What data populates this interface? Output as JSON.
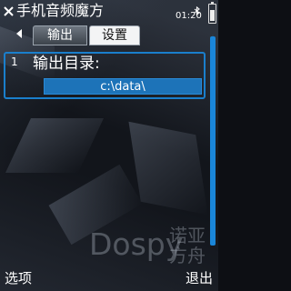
{
  "header": {
    "title": "手机音频魔方",
    "clock": "01:20",
    "close_icon": "close-icon",
    "bluetooth_icon": "bluetooth-icon",
    "battery_icon": "battery-icon"
  },
  "tabs": [
    {
      "label": "输出",
      "active": false
    },
    {
      "label": "设置",
      "active": true
    }
  ],
  "list": {
    "items": [
      {
        "index": "1",
        "label": "输出目录:",
        "value": "c:\\data\\"
      }
    ]
  },
  "watermark": {
    "brand": "Dospy",
    "cn": "诺亚方舟"
  },
  "softkeys": {
    "left": "选项",
    "right": "退出"
  },
  "colors": {
    "accent": "#1a7fcc",
    "selected_value_bg": "#1d73b8",
    "background": "#12151b"
  }
}
